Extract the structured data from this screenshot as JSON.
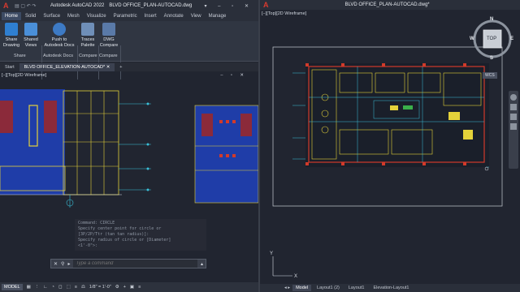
{
  "left_window": {
    "app_title": "Autodesk AutoCAD 2022",
    "doc_title": "BLVD OFFICE_PLAN-AUTOCAD.dwg",
    "ribbon_tabs": [
      "Home",
      "Solid",
      "Surface",
      "Mesh",
      "Visualize",
      "Parametric",
      "Insert",
      "Annotate",
      "View",
      "Manage"
    ],
    "active_ribbon_tab": "Home",
    "ribbon_buttons": [
      {
        "label_line1": "Share",
        "label_line2": "Drawing",
        "icon": "share-drawing-icon"
      },
      {
        "label_line1": "Shared",
        "label_line2": "Views",
        "icon": "shared-views-icon"
      },
      {
        "label_line1": "Push to",
        "label_line2": "Autodesk Docs",
        "icon": "push-to-docs-icon"
      },
      {
        "label_line1": "Traces",
        "label_line2": "Palette",
        "icon": "traces-palette-icon"
      },
      {
        "label_line1": "DWG",
        "label_line2": "Compare",
        "icon": "dwg-compare-icon"
      }
    ],
    "ribbon_panels": [
      "Share",
      "Autodesk Docs",
      "Compare",
      "Compare"
    ],
    "file_tabs": [
      "Start",
      "BLVD OFFICE_ELEVATION-AUTOCAD*"
    ],
    "viewport_label": "[−][Top][2D Wireframe]",
    "command_history": [
      "Command: CIRCLE",
      "Specify center point for circle or",
      "[3P/2P/Ttr (tan tan radius)]:",
      "Specify radius of circle or [Diameter]",
      "<1'-0\">:"
    ],
    "command_placeholder": "Type a command",
    "status": {
      "model": "MODEL",
      "scale": "1/8\" = 1'-0\""
    }
  },
  "right_window": {
    "doc_title": "BLVD OFFICE_PLAN-AUTOCAD.dwg*",
    "viewport_label": "[−][Top][2D Wireframe]",
    "viewcube": {
      "top": "TOP",
      "n": "N",
      "s": "S",
      "e": "E",
      "w": "W"
    },
    "wcs_label": "WCS",
    "layout_tabs": [
      "Model",
      "Layout1 (2)",
      "Layout1",
      "Elevation-Layout1"
    ],
    "active_layout": "Model"
  },
  "colors": {
    "background": "#212530",
    "ribbon": "#303642",
    "accent_blue": "#2f7fd0",
    "cad_blue": "#1f3da8",
    "cad_yellow": "#e4d23a",
    "cad_red": "#d23a2a",
    "cad_cyan": "#3ac0d8"
  }
}
